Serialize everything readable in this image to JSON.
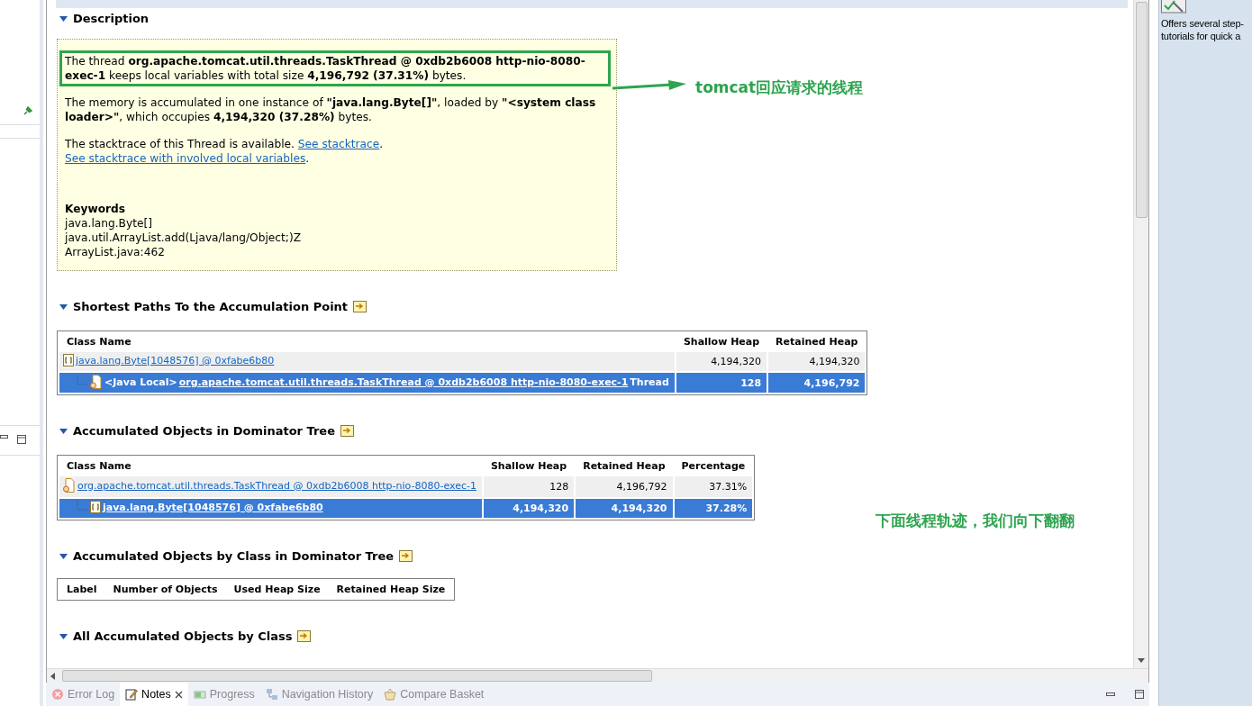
{
  "description": {
    "title": "Description",
    "expanded": true,
    "paragraphs": [
      {
        "highlighted": true,
        "parts": [
          {
            "kind": "text",
            "text": "The thread **org.apache.tomcat.util.threads.TaskThread @ 0xdb2b6008 http-nio-8080-exec-1** keeps local variables with total size **4,196,792 (37.31%)** bytes."
          }
        ]
      },
      {
        "highlighted": false,
        "parts": [
          {
            "kind": "text",
            "text": "The memory is accumulated in one instance of **\"java.lang.Byte[]\"**, loaded by **\"<system class loader>\"**, which occupies **4,194,320 (37.28%)** bytes."
          }
        ]
      },
      {
        "highlighted": false,
        "parts": [
          {
            "kind": "text",
            "text": "The stacktrace of this Thread is available. "
          },
          {
            "kind": "link",
            "text": "See stacktrace"
          },
          {
            "kind": "text",
            "text": ". "
          },
          {
            "kind": "link",
            "text": "See stacktrace with involved local variables"
          },
          {
            "kind": "text",
            "text": "."
          }
        ]
      }
    ],
    "keywords": {
      "title": "Keywords",
      "items": [
        "java.lang.Byte[]",
        "java.util.ArrayList.add(Ljava/lang/Object;)Z",
        "ArrayList.java:462"
      ]
    }
  },
  "sections": [
    {
      "title": "Shortest Paths To the Accumulation Point",
      "expanded": true,
      "columns": [
        "Class Name",
        "Shallow Heap",
        "Retained Heap"
      ],
      "rows": [
        {
          "kind": "array",
          "label": "java.lang.Byte[1048576] @ 0xfabe6b80",
          "values": [
            "4,194,320",
            "4,194,320"
          ],
          "selected": false,
          "children": [
            {
              "kind": "thread",
              "prefix": "<Java Local>",
              "label": "org.apache.tomcat.util.threads.TaskThread @ 0xdb2b6008 http-nio-8080-exec-1",
              "suffix": "Thread",
              "values": [
                "128",
                "4,196,792"
              ],
              "selected": true
            }
          ]
        }
      ]
    },
    {
      "title": "Accumulated Objects in Dominator Tree",
      "expanded": true,
      "columns": [
        "Class Name",
        "Shallow Heap",
        "Retained Heap",
        "Percentage"
      ],
      "rows": [
        {
          "kind": "thread",
          "label": "org.apache.tomcat.util.threads.TaskThread @ 0xdb2b6008 http-nio-8080-exec-1",
          "values": [
            "128",
            "4,196,792",
            "37.31%"
          ],
          "selected": false,
          "children": [
            {
              "kind": "array",
              "label": "java.lang.Byte[1048576] @ 0xfabe6b80",
              "values": [
                "4,194,320",
                "4,194,320",
                "37.28%"
              ],
              "selected": true
            }
          ]
        }
      ]
    },
    {
      "title": "Accumulated Objects by Class in Dominator Tree",
      "expanded": true,
      "columns": [
        "Label",
        "Number of Objects",
        "Used Heap Size",
        "Retained Heap Size"
      ]
    },
    {
      "title": "All Accumulated Objects by Class",
      "expanded": true
    }
  ],
  "annotations": [
    {
      "kind": "arrow",
      "text": "tomcat回应请求的线程"
    },
    {
      "kind": "note",
      "text": "下面线程轨迹，我们向下翻翻"
    }
  ],
  "bottom_tabs": [
    {
      "label": "Error Log",
      "selected": false
    },
    {
      "label": "Notes",
      "selected": true
    },
    {
      "label": "Progress",
      "selected": false
    },
    {
      "label": "Navigation History",
      "selected": false
    },
    {
      "label": "Compare Basket",
      "selected": false
    }
  ],
  "help_panel": {
    "lines": [
      "Offers several step-",
      "tutorials for quick a"
    ]
  }
}
